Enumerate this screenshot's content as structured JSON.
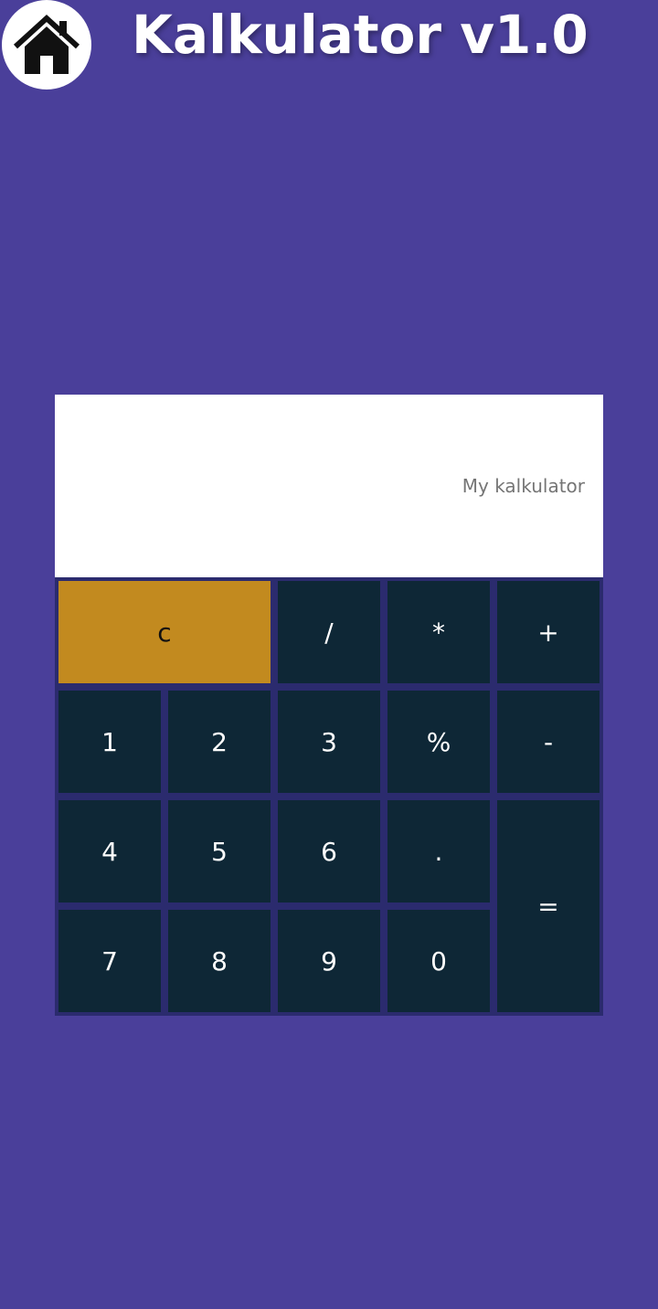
{
  "header": {
    "title": "Kalkulator v1.0",
    "home_icon": "home-icon"
  },
  "display": {
    "text": "My kalkulator"
  },
  "keypad": {
    "clear": "c",
    "divide": "/",
    "multiply": "*",
    "add": "+",
    "one": "1",
    "two": "2",
    "three": "3",
    "percent": "%",
    "subtract": "-",
    "four": "4",
    "five": "5",
    "six": "6",
    "decimal": ".",
    "equals": "=",
    "seven": "7",
    "eight": "8",
    "nine": "9",
    "zero": "0"
  },
  "colors": {
    "background": "#4a3f9a",
    "key": "#0e2736",
    "clear_key": "#c28a1f",
    "keypad_gap": "#2b2b6e",
    "display": "#ffffff"
  }
}
